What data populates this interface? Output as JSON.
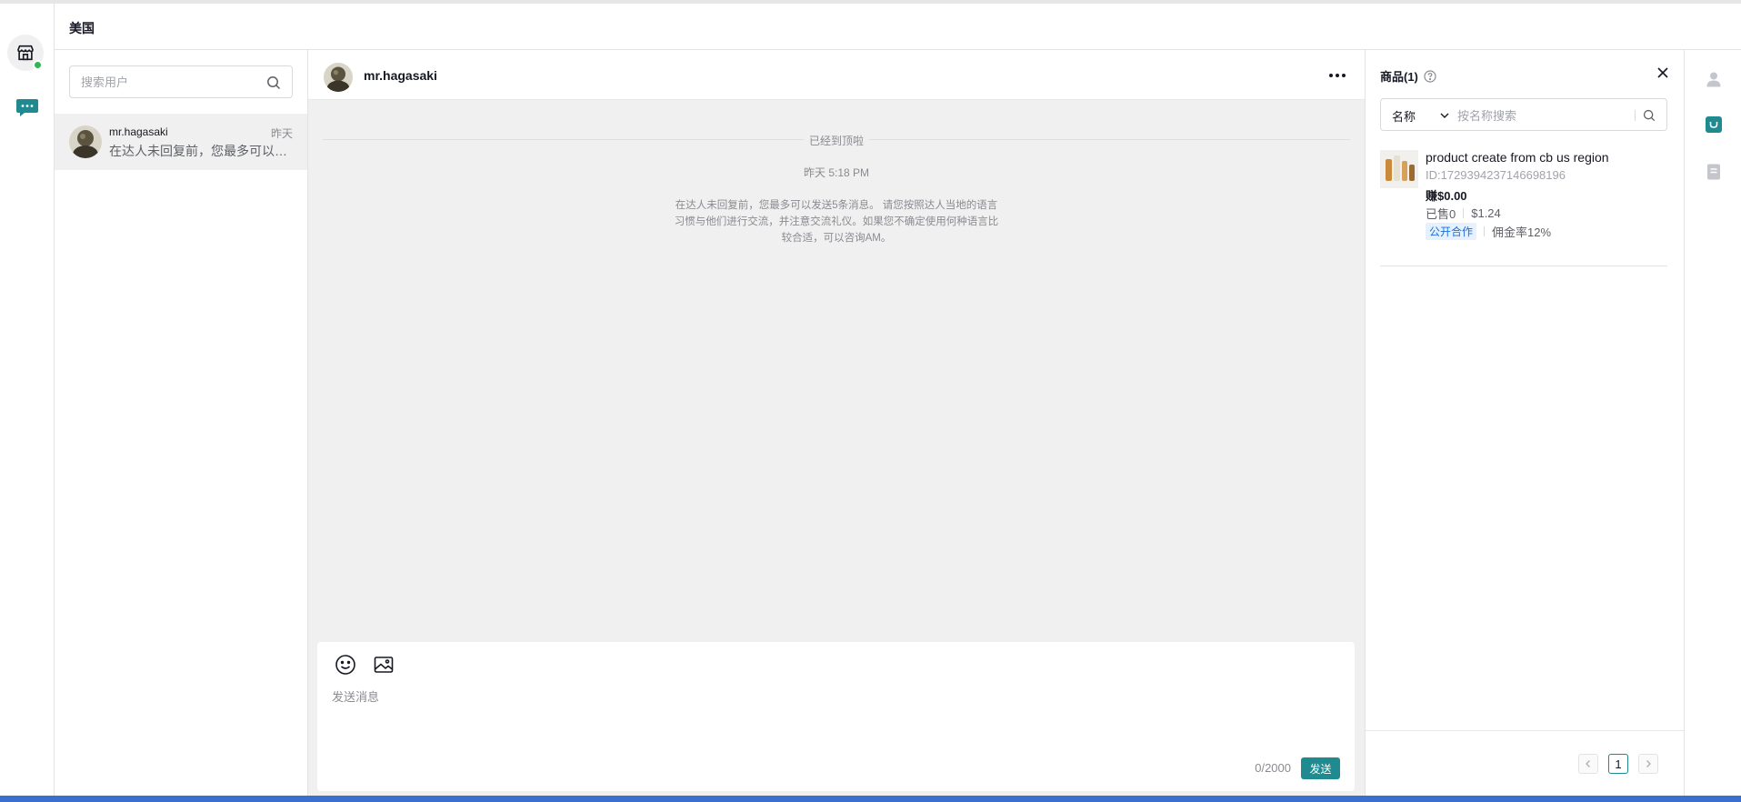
{
  "header": {
    "region": "美国"
  },
  "userlist": {
    "search_placeholder": "搜索用户",
    "items": [
      {
        "name": "mr.hagasaki",
        "time": "昨天",
        "preview": "在达人未回复前，您最多可以发送5条消息。"
      }
    ]
  },
  "chat": {
    "name": "mr.hagasaki",
    "top_notice": "已经到顶啦",
    "time": "昨天 5:18 PM",
    "system_note": "在达人未回复前，您最多可以发送5条消息。 请您按照达人当地的语言习惯与他们进行交流，并注意交流礼仪。如果您不确定使用何种语言比较合适，可以咨询AM。",
    "composer": {
      "placeholder": "发送消息",
      "char_count": "0/2000",
      "send_label": "发送"
    }
  },
  "products": {
    "title": "商品(1)",
    "filter_field": "名称",
    "search_placeholder": "按名称搜索",
    "items": [
      {
        "name": "product create from cb us region",
        "id": "ID:1729394237146698196",
        "earn": "赚$0.00",
        "sold": "已售0",
        "price": "$1.24",
        "tag": "公开合作",
        "commission": "佣金率12%"
      }
    ],
    "page": "1"
  },
  "colors": {
    "accent": "#1f8a8f",
    "online": "#35b35a",
    "tag_blue": "#1d6fdc"
  }
}
